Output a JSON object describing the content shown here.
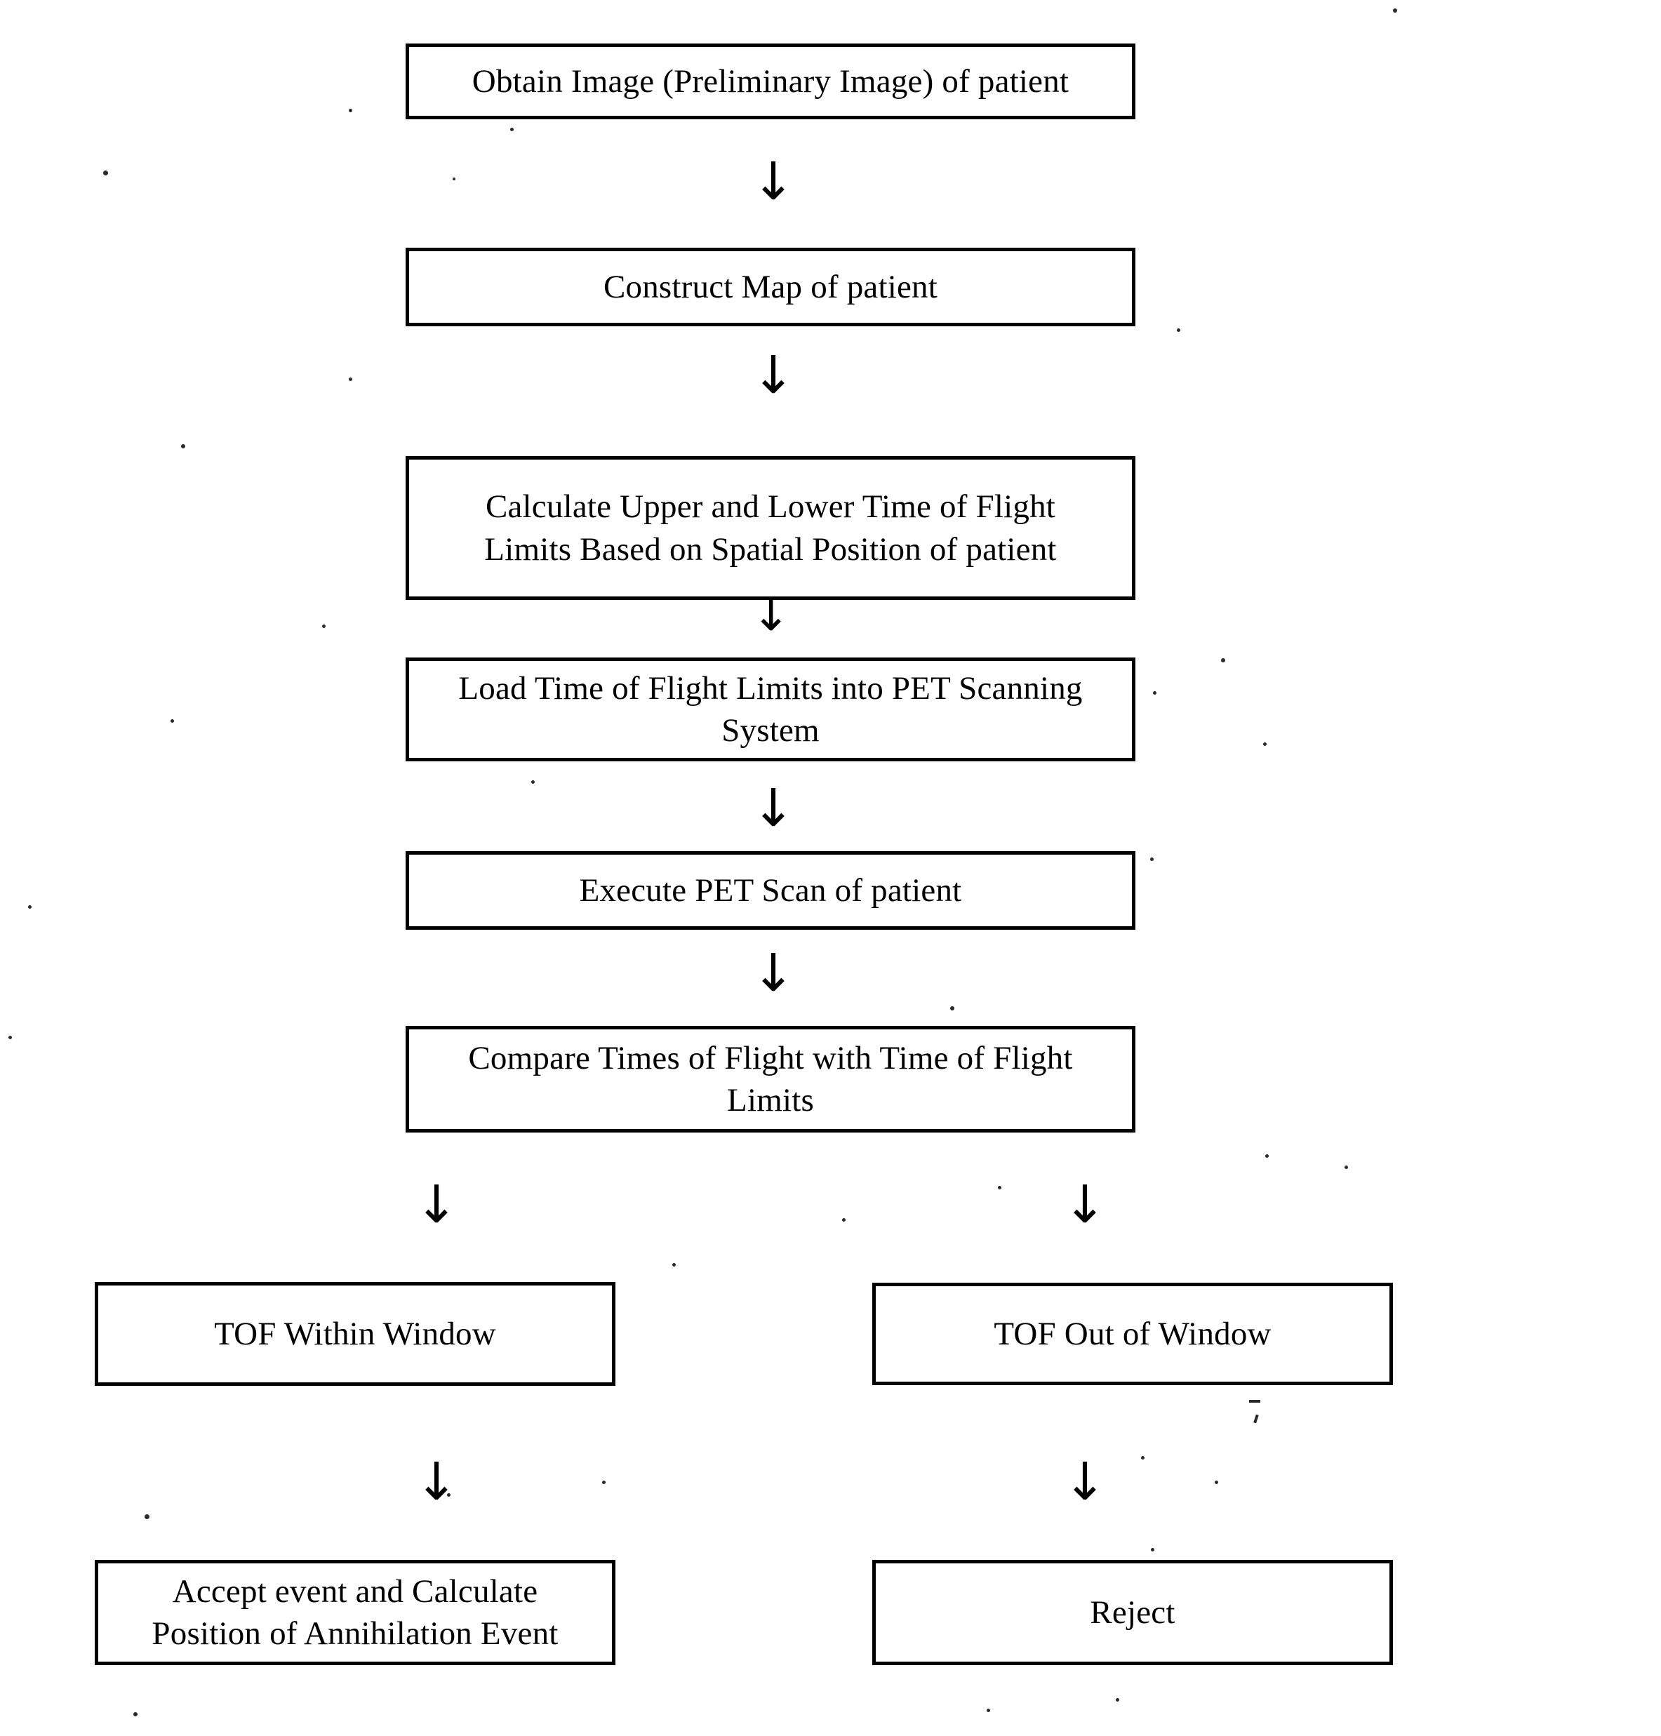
{
  "diagram": {
    "title": "PET Time of Flight Scanning Process Flowchart",
    "background_color": "#ffffff",
    "line_color": "#000000",
    "nodes": [
      {
        "id": "obtain-image",
        "label": "Obtain Image (Preliminary Image) of patient"
      },
      {
        "id": "construct-map",
        "label": "Construct Map of patient"
      },
      {
        "id": "calculate-limits",
        "label": "Calculate Upper and Lower Time of Flight\nLimits Based on Spatial Position of patient"
      },
      {
        "id": "load-limits",
        "label": "Load Time of Flight Limits into PET Scanning\nSystem"
      },
      {
        "id": "execute-scan",
        "label": "Execute PET Scan of patient"
      },
      {
        "id": "compare-times",
        "label": "Compare Times of Flight with Time of Flight\nLimits"
      },
      {
        "id": "tof-within",
        "label": "TOF Within Window"
      },
      {
        "id": "tof-out",
        "label": "TOF Out of Window"
      },
      {
        "id": "accept-event",
        "label": "Accept event and Calculate\nPosition of Annihilation Event"
      },
      {
        "id": "reject",
        "label": "Reject"
      }
    ],
    "connectors": [
      {
        "id": "arrow-1",
        "glyph": "↓",
        "from": "obtain-image",
        "to": "construct-map"
      },
      {
        "id": "arrow-2",
        "glyph": "↓",
        "from": "construct-map",
        "to": "calculate-limits"
      },
      {
        "id": "arrow-3",
        "glyph": "↓",
        "from": "calculate-limits",
        "to": "load-limits"
      },
      {
        "id": "arrow-4",
        "glyph": "↓",
        "from": "load-limits",
        "to": "execute-scan"
      },
      {
        "id": "arrow-5",
        "glyph": "↓",
        "from": "execute-scan",
        "to": "compare-times"
      },
      {
        "id": "arrow-6",
        "glyph": "↓",
        "from": "compare-times",
        "to": "tof-within"
      },
      {
        "id": "arrow-7",
        "glyph": "↓",
        "from": "compare-times",
        "to": "tof-out"
      },
      {
        "id": "arrow-8",
        "glyph": "↓",
        "from": "tof-within",
        "to": "accept-event"
      },
      {
        "id": "arrow-9",
        "glyph": "↓",
        "from": "tof-out",
        "to": "reject"
      }
    ]
  }
}
